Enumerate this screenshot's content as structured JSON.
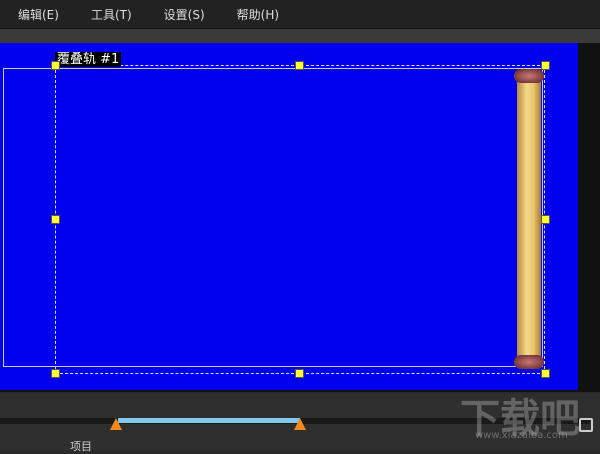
{
  "menu": [
    "编辑(E)",
    "工具(T)",
    "设置(S)",
    "帮助(H)"
  ],
  "overlay_label": "覆叠轨 #1",
  "bottom": {
    "project_label": "项目"
  },
  "watermark": "下载吧",
  "watermark_url": "www.xiazaiba.com",
  "colors": {
    "canvas": "#0000ee",
    "range": "#80c8ea",
    "marker": "#f08a1c"
  }
}
